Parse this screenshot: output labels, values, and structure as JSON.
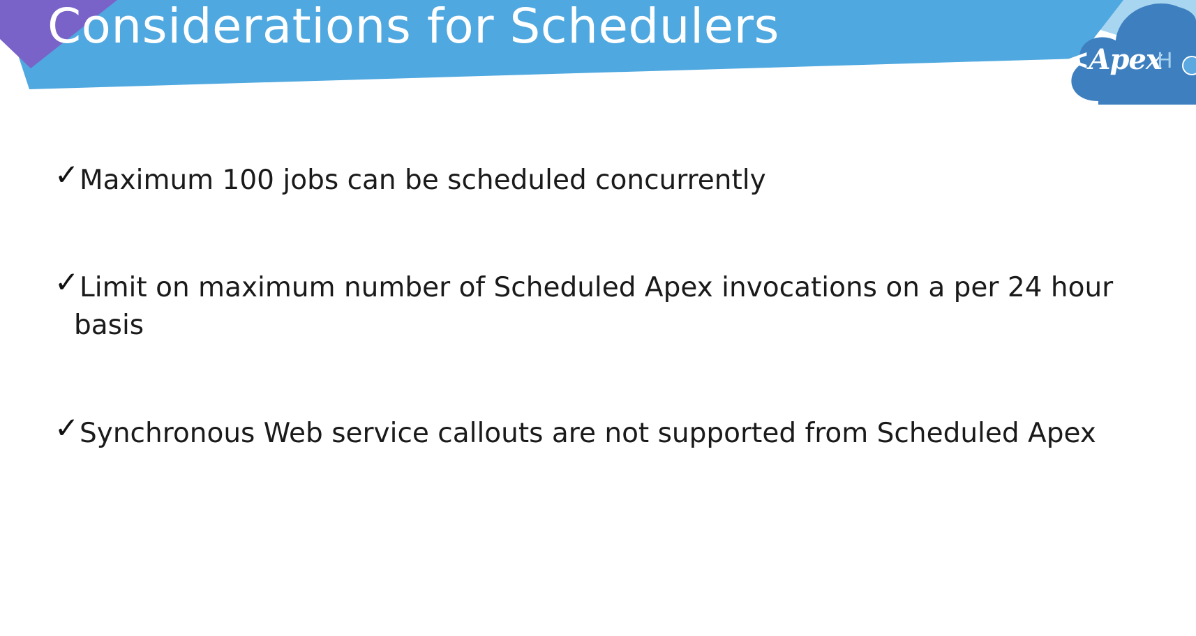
{
  "slide": {
    "title": "Considerations for Schedulers",
    "logo": {
      "text": "<Apex",
      "suffix": "H"
    },
    "bullets": [
      {
        "check": "✓",
        "text": "Maximum 100 jobs can be scheduled concurrently"
      },
      {
        "check": "✓",
        "text_line1": "Limit on maximum number of Scheduled Apex invocations on a per 24 hour",
        "text_line2": "basis"
      },
      {
        "check": "✓",
        "text": "Synchronous Web service callouts are not supported from Scheduled Apex"
      }
    ]
  },
  "colors": {
    "band_blue": "#4fa8df",
    "band_purple": "#7a63c8",
    "logo_cloud": "#3d7fbf",
    "text_dark": "#1a1a1a"
  }
}
